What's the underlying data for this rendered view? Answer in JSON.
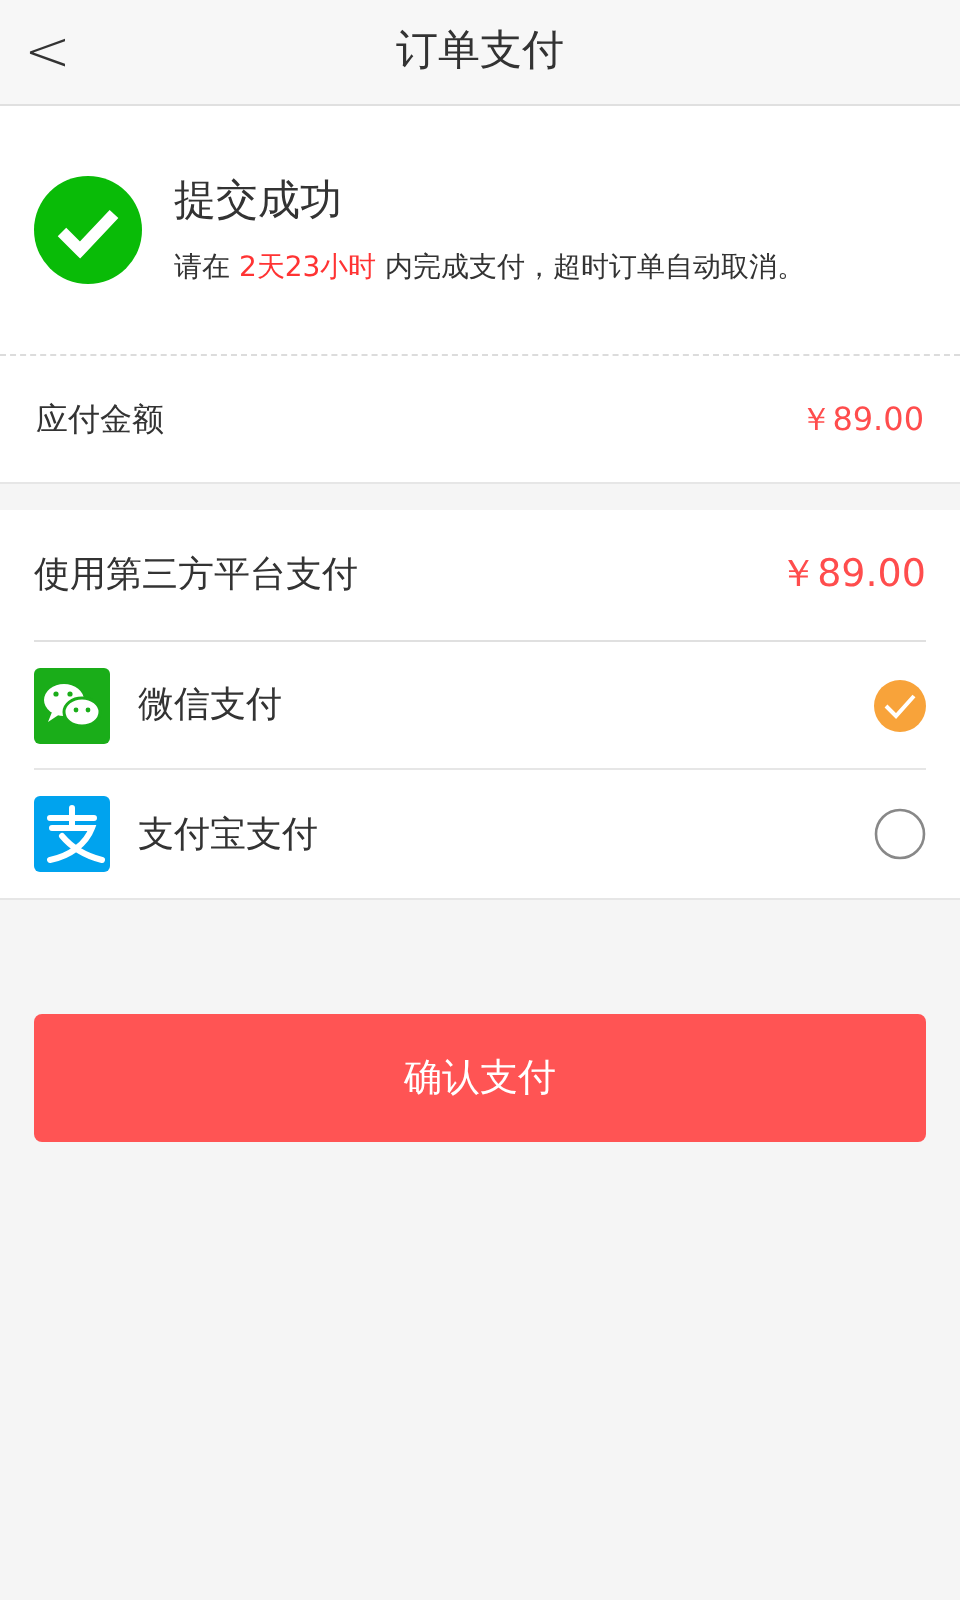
{
  "header": {
    "back": "<",
    "title": "订单支付"
  },
  "result": {
    "title": "提交成功",
    "notice_before": "请在",
    "notice_highlight": "2天23小时",
    "notice_after": "内完成支付，超时订单自动取消。"
  },
  "amount": {
    "label": "应付金额",
    "value": "￥89.00"
  },
  "payment": {
    "label": "使用第三方平台支付",
    "value": "￥89.00",
    "methods": [
      {
        "kind": "wechat",
        "label": "微信支付",
        "selected": true
      },
      {
        "kind": "alipay",
        "label": "支付宝支付",
        "selected": false
      }
    ]
  },
  "confirm_button": "确认支付"
}
